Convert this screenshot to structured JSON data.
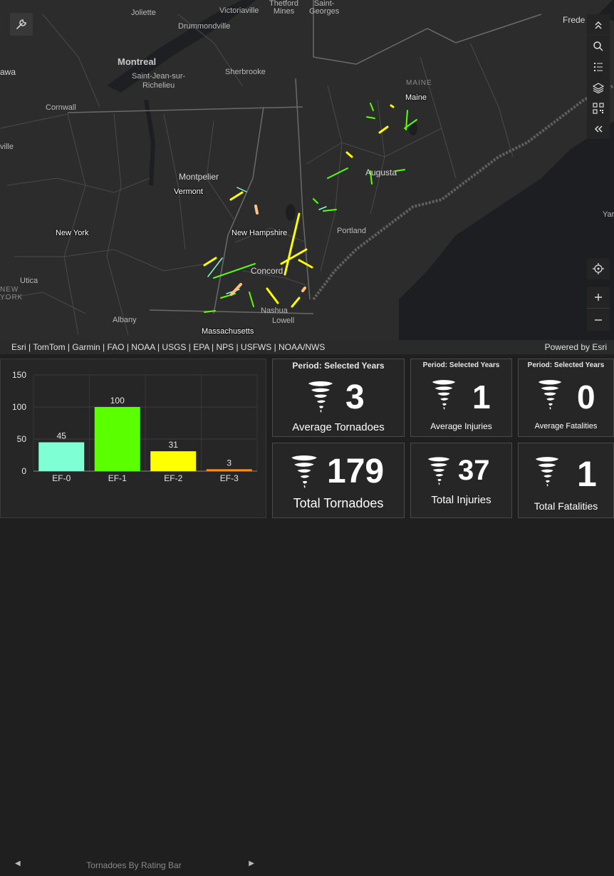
{
  "map": {
    "labels": {
      "joliette": "Joliette",
      "victoriaville": "Victoriaville",
      "thetford": "Thetford\nMines",
      "saint_georges": "Saint-\nGeorges",
      "drummondville": "Drummondville",
      "frede": "Frede",
      "montreal": "Montreal",
      "saint_jean": "Saint-Jean-sur-\nRichelieu",
      "sherbrooke": "Sherbrooke",
      "awa": "awa",
      "maine_state": "MAINE",
      "maine": "Maine",
      "cornwall": "Cornwall",
      "ville": "ville",
      "montpelier": "Montpelier",
      "vermont": "Vermont",
      "augusta": "Augusta",
      "portland": "Portland",
      "yar": "Yar",
      "new_york": "New York",
      "new_hampshire": "New Hampshire",
      "concord": "Concord",
      "utica": "Utica",
      "new_state": "NEW\nYORK",
      "albany": "Albany",
      "nashua": "Nashua",
      "lowell": "Lowell",
      "massachusetts": "Massachusetts"
    },
    "attribution": "Esri | TomTom | Garmin | FAO | NOAA | USGS | EPA | NPS | USFWS | NOAA/NWS",
    "powered_by": "Powered by Esri",
    "tornado_colors": {
      "EF-0": "#7fffd4",
      "EF-1": "#5aff00",
      "EF-2": "#ffff00",
      "EF-3": "#ffc080"
    }
  },
  "chart_data": {
    "type": "bar",
    "categories": [
      "EF-0",
      "EF-1",
      "EF-2",
      "EF-3"
    ],
    "values": [
      45,
      100,
      31,
      3
    ],
    "colors": [
      "#7fffd4",
      "#5aff00",
      "#ffff00",
      "#ff8c1a"
    ],
    "yticks": [
      0,
      50,
      100,
      150
    ],
    "ylim": [
      0,
      150
    ],
    "title": "Tornadoes By Rating Bar",
    "grid": true
  },
  "cards": [
    {
      "period": "Period: Selected Years",
      "value": "3",
      "title": "Average Tornadoes"
    },
    {
      "period": "Period: Selected Years",
      "value": "1",
      "title": "Average Injuries"
    },
    {
      "period": "Period: Selected Years",
      "value": "0",
      "title": "Average Fatalities"
    },
    {
      "value": "179",
      "title": "Total Tornadoes"
    },
    {
      "value": "37",
      "title": "Total Injuries"
    },
    {
      "value": "1",
      "title": "Total Fatalities"
    }
  ],
  "icons": {
    "tool": "wrench-icon",
    "collapse": "chevron-up-double-icon",
    "search": "search-icon",
    "list": "list-icon",
    "layers": "layers-icon",
    "qr": "qr-icon",
    "expand": "chevron-left-double-icon",
    "locate": "locate-icon",
    "zoom_in": "plus-icon",
    "zoom_out": "minus-icon",
    "tornado": "tornado-icon"
  }
}
